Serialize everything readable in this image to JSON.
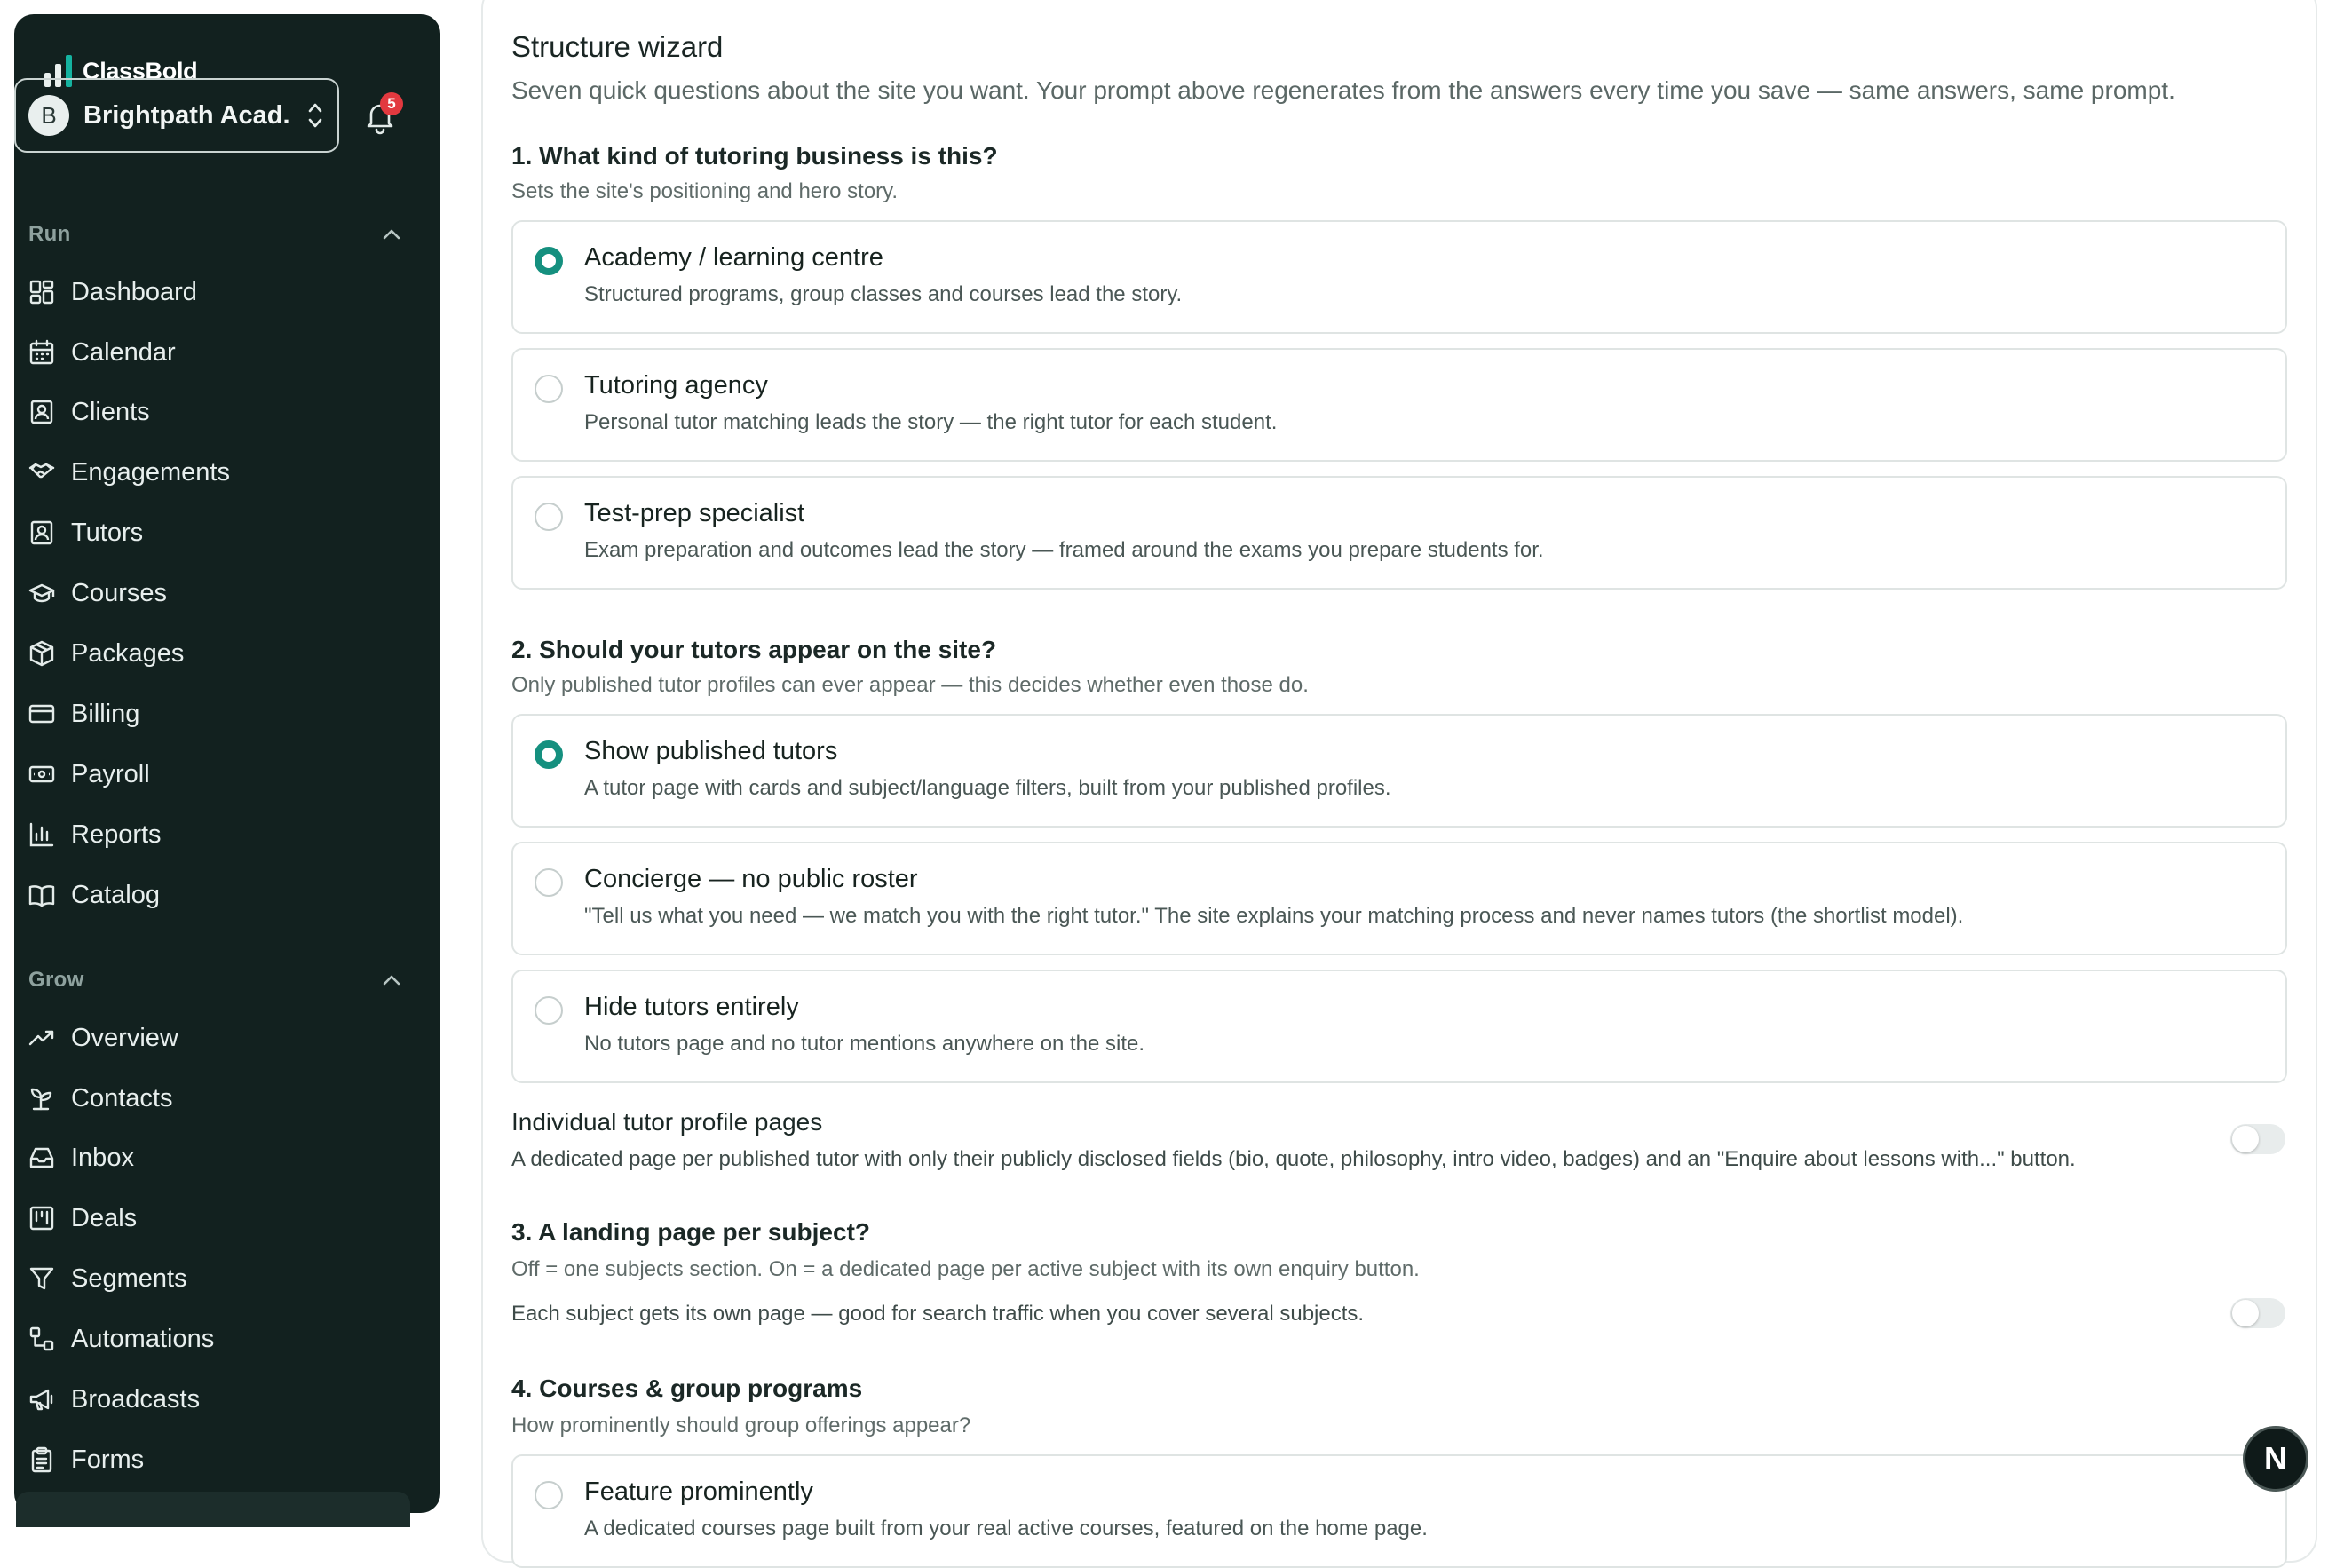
{
  "sidebar": {
    "brand": "ClassBold",
    "org": {
      "initial": "B",
      "name": "Brightpath Acad..."
    },
    "notifications": {
      "count": "5"
    },
    "sections": [
      {
        "title": "Run",
        "items": [
          {
            "label": "Dashboard",
            "icon": "dashboard-icon"
          },
          {
            "label": "Calendar",
            "icon": "calendar-icon"
          },
          {
            "label": "Clients",
            "icon": "clients-icon"
          },
          {
            "label": "Engagements",
            "icon": "handshake-icon"
          },
          {
            "label": "Tutors",
            "icon": "tutors-icon"
          },
          {
            "label": "Courses",
            "icon": "graduation-cap-icon"
          },
          {
            "label": "Packages",
            "icon": "package-icon"
          },
          {
            "label": "Billing",
            "icon": "credit-card-icon"
          },
          {
            "label": "Payroll",
            "icon": "banknote-icon"
          },
          {
            "label": "Reports",
            "icon": "bar-chart-icon"
          },
          {
            "label": "Catalog",
            "icon": "book-open-icon"
          }
        ]
      },
      {
        "title": "Grow",
        "items": [
          {
            "label": "Overview",
            "icon": "trending-up-icon"
          },
          {
            "label": "Contacts",
            "icon": "sprout-icon"
          },
          {
            "label": "Inbox",
            "icon": "inbox-icon"
          },
          {
            "label": "Deals",
            "icon": "kanban-icon"
          },
          {
            "label": "Segments",
            "icon": "filter-icon"
          },
          {
            "label": "Automations",
            "icon": "workflow-icon"
          },
          {
            "label": "Broadcasts",
            "icon": "megaphone-icon"
          },
          {
            "label": "Forms",
            "icon": "clipboard-icon"
          }
        ]
      }
    ]
  },
  "wizard": {
    "title": "Structure wizard",
    "subtitle": "Seven quick questions about the site you want. Your prompt above regenerates from the answers every time you save — same answers, same prompt.",
    "q1": {
      "title": "1. What kind of tutoring business is this?",
      "help": "Sets the site's positioning and hero story.",
      "options": [
        {
          "label": "Academy / learning centre",
          "desc": "Structured programs, group classes and courses lead the story.",
          "selected": true
        },
        {
          "label": "Tutoring agency",
          "desc": "Personal tutor matching leads the story — the right tutor for each student.",
          "selected": false
        },
        {
          "label": "Test-prep specialist",
          "desc": "Exam preparation and outcomes lead the story — framed around the exams you prepare students for.",
          "selected": false
        }
      ]
    },
    "q2": {
      "title": "2. Should your tutors appear on the site?",
      "help": "Only published tutor profiles can ever appear — this decides whether even those do.",
      "options": [
        {
          "label": "Show published tutors",
          "desc": "A tutor page with cards and subject/language filters, built from your published profiles.",
          "selected": true
        },
        {
          "label": "Concierge — no public roster",
          "desc": "\"Tell us what you need — we match you with the right tutor.\" The site explains your matching process and never names tutors (the shortlist model).",
          "selected": false
        },
        {
          "label": "Hide tutors entirely",
          "desc": "No tutors page and no tutor mentions anywhere on the site.",
          "selected": false
        }
      ],
      "profile_pages": {
        "label": "Individual tutor profile pages",
        "desc": "A dedicated page per published tutor with only their publicly disclosed fields (bio, quote, philosophy, intro video, badges) and an \"Enquire about lessons with...\" button.",
        "enabled": false
      }
    },
    "q3": {
      "title": "3. A landing page per subject?",
      "help": "Off = one subjects section. On = a dedicated page per active subject with its own enquiry button.",
      "toggle_label": "Each subject gets its own page — good for search traffic when you cover several subjects.",
      "enabled": false
    },
    "q4": {
      "title": "4. Courses & group programs",
      "help": "How prominently should group offerings appear?",
      "options": [
        {
          "label": "Feature prominently",
          "desc": "A dedicated courses page built from your real active courses, featured on the home page.",
          "selected": false
        }
      ]
    }
  },
  "assistant_fab": {
    "label": "N"
  },
  "colors": {
    "sidebar_bg": "#12211f",
    "accent": "#15907f",
    "badge": "#e2393f"
  }
}
